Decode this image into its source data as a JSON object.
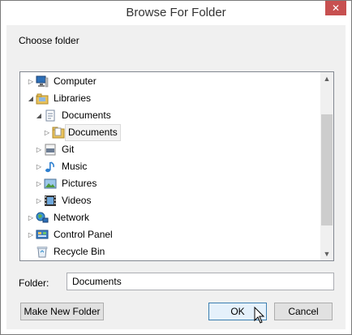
{
  "window": {
    "title": "Browse For Folder",
    "close_glyph": "✕"
  },
  "prompt": "Choose folder",
  "tree": {
    "items": [
      {
        "label": "Computer",
        "icon": "computer-icon",
        "expander": "▷"
      },
      {
        "label": "Libraries",
        "icon": "library-icon",
        "expander": "◢"
      },
      {
        "label": "Documents",
        "icon": "documents-library-icon",
        "expander": "◢"
      },
      {
        "label": "Documents",
        "icon": "folder-icon",
        "expander": "▷"
      },
      {
        "label": "Git",
        "icon": "git-library-icon",
        "expander": "▷"
      },
      {
        "label": "Music",
        "icon": "music-icon",
        "expander": "▷"
      },
      {
        "label": "Pictures",
        "icon": "pictures-icon",
        "expander": "▷"
      },
      {
        "label": "Videos",
        "icon": "videos-icon",
        "expander": "▷"
      },
      {
        "label": "Network",
        "icon": "network-icon",
        "expander": "▷"
      },
      {
        "label": "Control Panel",
        "icon": "control-panel-icon",
        "expander": "▷"
      },
      {
        "label": "Recycle Bin",
        "icon": "recycle-bin-icon",
        "expander": ""
      }
    ],
    "scroll_up_glyph": "▲",
    "scroll_down_glyph": "▼"
  },
  "folder": {
    "label": "Folder:",
    "value": "Documents"
  },
  "buttons": {
    "new_folder": "Make New Folder",
    "ok": "OK",
    "cancel": "Cancel"
  },
  "colors": {
    "accent": "#3c7fb1",
    "close": "#c75050",
    "folder": "#e8c25c"
  }
}
